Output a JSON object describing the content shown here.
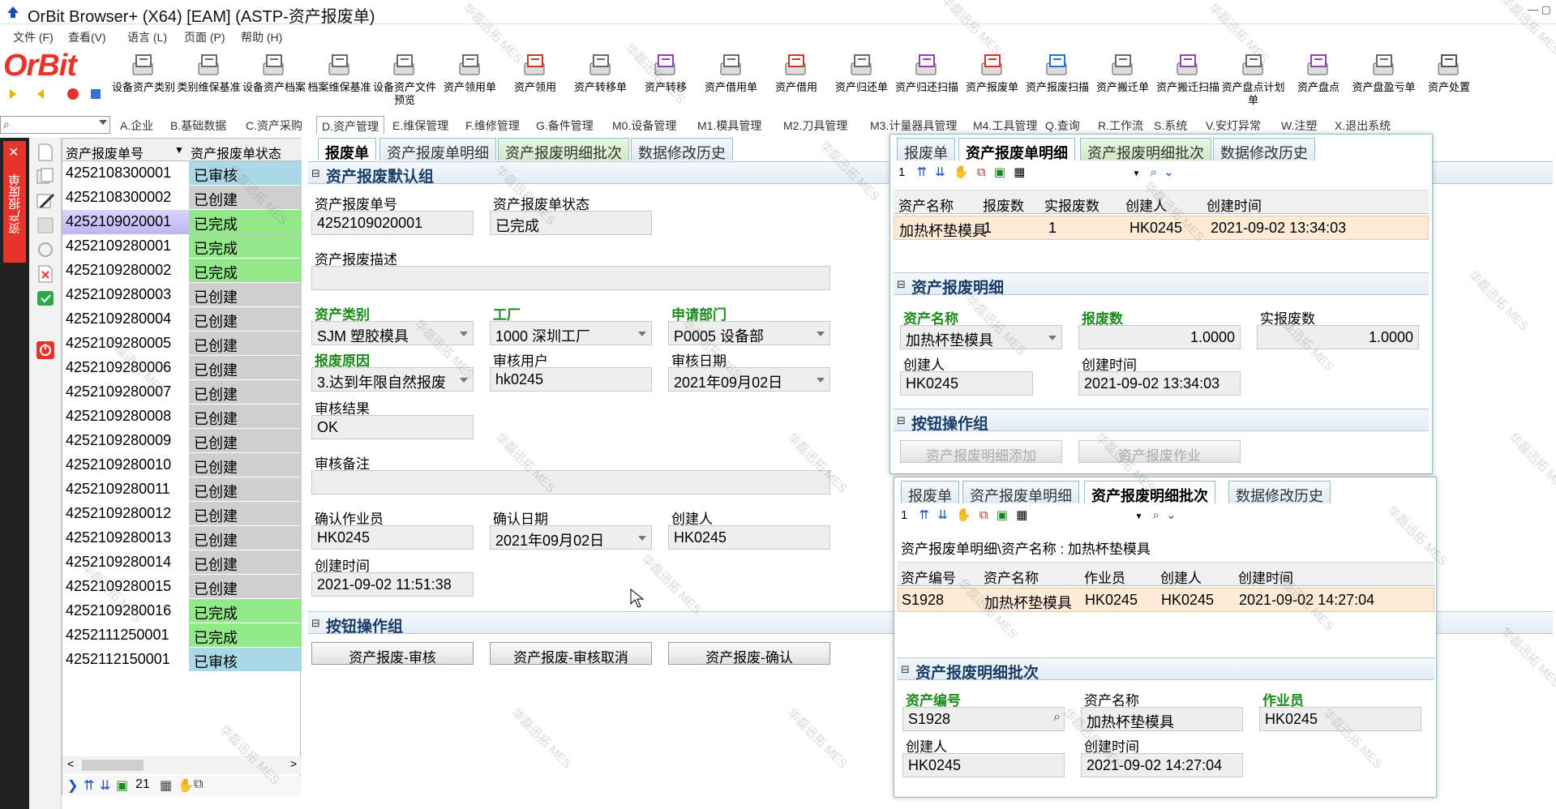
{
  "window": {
    "title": "OrBit Browser+ (X64) [EAM] (ASTP-资产报废单)"
  },
  "menubar": [
    "文件 (F)",
    "查看(V)",
    "语言 (L)",
    "页面 (P)",
    "帮助 (H)"
  ],
  "logo": "OrBit",
  "toolbar": [
    "设备资产类别",
    "类别维保基准",
    "设备资产档案",
    "档案维保基准",
    "设备资产文件预览",
    "资产领用单",
    "资产领用",
    "资产转移单",
    "资产转移",
    "资产借用单",
    "资产借用",
    "资产归还单",
    "资产归还扫描",
    "资产报废单",
    "资产报废扫描",
    "资产搬迁单",
    "资产搬迁扫描",
    "资产盘点计划单",
    "资产盘点",
    "资产盘盈亏单",
    "资产处置"
  ],
  "module_tabs": [
    "A.企业",
    "B.基础数据",
    "C.资产采购",
    "D.资产管理",
    "E.维保管理",
    "F.维修管理",
    "G.备件管理",
    "M0.设备管理",
    "M1.模具管理",
    "M2.刀具管理",
    "M3.计量器具管理",
    "M4.工具管理",
    "Q.查询",
    "R.工作流",
    "S.系统",
    "V.安灯异常",
    "W.注塑",
    "X.退出系统"
  ],
  "vertical_tab": "资产报废单",
  "list": {
    "col_no": "资产报废单号",
    "col_status": "资产报废单状态",
    "rows": [
      {
        "no": "4252108300001",
        "status": "已审核"
      },
      {
        "no": "4252108300002",
        "status": "已创建"
      },
      {
        "no": "4252109020001",
        "status": "已完成"
      },
      {
        "no": "4252109280001",
        "status": "已完成"
      },
      {
        "no": "4252109280002",
        "status": "已完成"
      },
      {
        "no": "4252109280003",
        "status": "已创建"
      },
      {
        "no": "4252109280004",
        "status": "已创建"
      },
      {
        "no": "4252109280005",
        "status": "已创建"
      },
      {
        "no": "4252109280006",
        "status": "已创建"
      },
      {
        "no": "4252109280007",
        "status": "已创建"
      },
      {
        "no": "4252109280008",
        "status": "已创建"
      },
      {
        "no": "4252109280009",
        "status": "已创建"
      },
      {
        "no": "4252109280010",
        "status": "已创建"
      },
      {
        "no": "4252109280011",
        "status": "已创建"
      },
      {
        "no": "4252109280012",
        "status": "已创建"
      },
      {
        "no": "4252109280013",
        "status": "已创建"
      },
      {
        "no": "4252109280014",
        "status": "已创建"
      },
      {
        "no": "4252109280015",
        "status": "已创建"
      },
      {
        "no": "4252109280016",
        "status": "已完成"
      },
      {
        "no": "4252111250001",
        "status": "已完成"
      },
      {
        "no": "4252112150001",
        "status": "已审核"
      }
    ],
    "selected_index": 2,
    "footer_count": "21",
    "status_colors": {
      "已审核": "#a9d8e6",
      "已创建": "#cfcfcf",
      "已完成": "#93e889"
    }
  },
  "main": {
    "tabs": [
      "报废单",
      "资产报废单明细",
      "资产报废明细批次",
      "数据修改历史"
    ],
    "section_default": "资产报废默认组",
    "f_no_label": "资产报废单号",
    "f_no_value": "4252109020001",
    "f_state_label": "资产报废单状态",
    "f_state_value": "已完成",
    "f_desc_label": "资产报废描述",
    "f_desc_value": "",
    "f_cat_label": "资产类别",
    "f_cat_value": "SJM 塑胶模具",
    "f_plant_label": "工厂",
    "f_plant_value": "1000 深圳工厂",
    "f_dept_label": "申请部门",
    "f_dept_value": "P0005 设备部",
    "f_reason_label": "报废原因",
    "f_reason_value": "3.达到年限自然报废",
    "f_auditor_label": "审核用户",
    "f_auditor_value": "hk0245",
    "f_auditdate_label": "审核日期",
    "f_auditdate_value": "2021年09月02日",
    "f_result_label": "审核结果",
    "f_result_value": "OK",
    "f_remark_label": "审核备注",
    "f_remark_value": "",
    "f_confirmer_label": "确认作业员",
    "f_confirmer_value": "HK0245",
    "f_confirmdate_label": "确认日期",
    "f_confirmdate_value": "2021年09月02日",
    "f_creator_label": "创建人",
    "f_creator_value": "HK0245",
    "f_ctime_label": "创建时间",
    "f_ctime_value": "2021-09-02 11:51:38",
    "section_buttons": "按钮操作组",
    "btn_audit": "资产报废-审核",
    "btn_cancel": "资产报废-审核取消",
    "btn_confirm": "资产报废-确认"
  },
  "detail": {
    "tabs": [
      "报废单",
      "资产报废单明细",
      "资产报废明细批次",
      "数据修改历史"
    ],
    "pager": "1",
    "cols": [
      "资产名称",
      "报废数",
      "实报废数",
      "创建人",
      "创建时间"
    ],
    "row": [
      "加热杯垫模具",
      "1",
      "1",
      "HK0245",
      "2021-09-02 13:34:03"
    ],
    "section": "资产报废明细",
    "name_label": "资产名称",
    "name_value": "加热杯垫模具",
    "qty_label": "报废数",
    "qty_value": "1.0000",
    "real_label": "实报废数",
    "real_value": "1.0000",
    "creator_label": "创建人",
    "creator_value": "HK0245",
    "ctime_label": "创建时间",
    "ctime_value": "2021-09-02 13:34:03",
    "section_buttons": "按钮操作组",
    "btn_add": "资产报废明细添加",
    "btn_job": "资产报废作业"
  },
  "batch": {
    "tabs": [
      "报废单",
      "资产报废单明细",
      "资产报废明细批次",
      "数据修改历史"
    ],
    "pager": "1",
    "path": "资产报废单明细\\资产名称 : 加热杯垫模具",
    "cols": [
      "资产编号",
      "资产名称",
      "作业员",
      "创建人",
      "创建时间"
    ],
    "row": [
      "S1928",
      "加热杯垫模具",
      "HK0245",
      "HK0245",
      "2021-09-02 14:27:04"
    ],
    "section": "资产报废明细批次",
    "code_label": "资产编号",
    "code_value": "S1928",
    "name_label": "资产名称",
    "name_value": "加热杯垫模具",
    "op_label": "作业员",
    "op_value": "HK0245",
    "creator_label": "创建人",
    "creator_value": "HK0245",
    "ctime_label": "创建时间",
    "ctime_value": "2021-09-02 14:27:04"
  },
  "watermark": "华磊迅拓 MES"
}
